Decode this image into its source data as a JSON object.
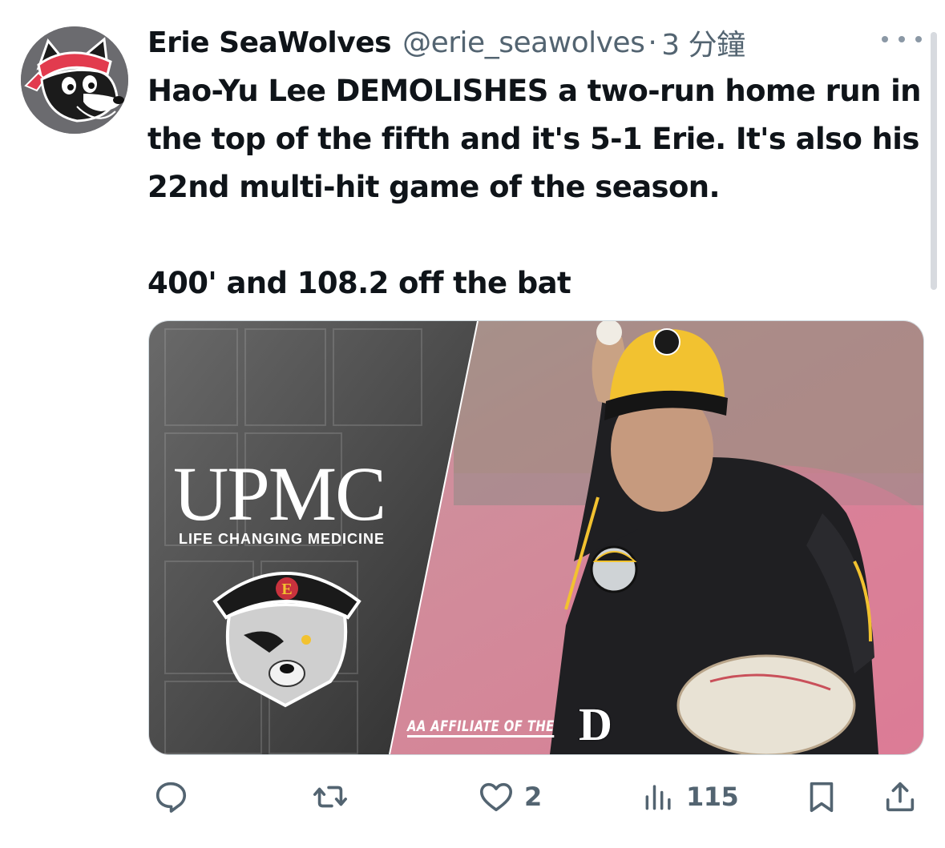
{
  "author": {
    "name": "Erie SeaWolves",
    "handle": "@erie_seawolves",
    "separator": "·",
    "time": "3 分鐘"
  },
  "tweet": {
    "paragraph_1": "Hao-Yu Lee DEMOLISHES a two-run home run in the top of the fifth and it's 5-1 Erie. It's also his 22nd multi-hit game of the season.",
    "paragraph_2": "400' and 108.2 off the bat"
  },
  "media": {
    "brand": "UPMC",
    "brand_tagline": "LIFE CHANGING MEDICINE",
    "affiliate_text": "AA AFFILIATE OF THE",
    "affiliate_logo_letter": "D",
    "cap_letter": "E"
  },
  "actions": {
    "reply_count": "",
    "repost_count": "",
    "like_count": "2",
    "views_count": "115"
  },
  "icons": {
    "more": "more-horizontal-icon",
    "reply": "reply-icon",
    "repost": "repost-icon",
    "like": "heart-icon",
    "views": "views-chart-icon",
    "bookmark": "bookmark-icon",
    "share": "share-icon"
  },
  "colors": {
    "text": "#0f1419",
    "secondary": "#536471",
    "upmc_bg": "#4a4a4a",
    "photo_pink": "#d98a9c",
    "jersey_yellow": "#f2c230"
  }
}
